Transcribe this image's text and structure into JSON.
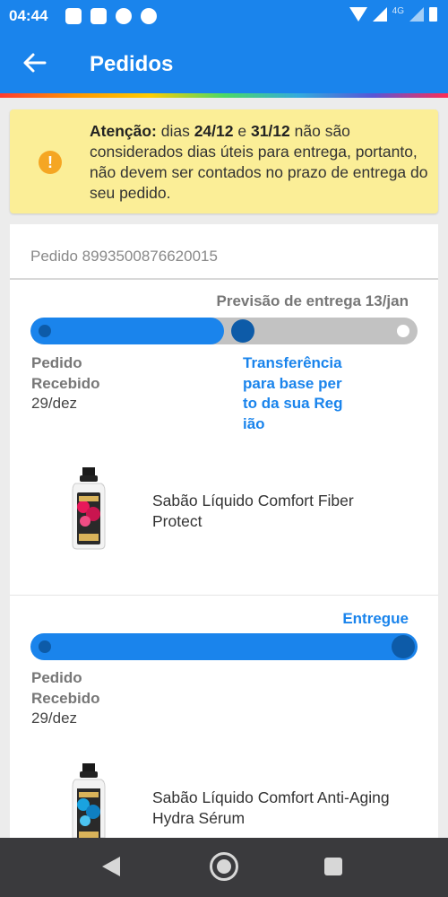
{
  "status_bar": {
    "time": "04:44",
    "network_label": "4G"
  },
  "appbar": {
    "title": "Pedidos"
  },
  "alert": {
    "prefix": "Atenção:",
    "t1": " dias ",
    "date1": "24/12",
    "t2": " e ",
    "date2": "31/12",
    "t3": " não são considerados dias úteis para entrega, portanto, não devem ser contados no prazo de entrega do seu pedido.",
    "icon_glyph": "!"
  },
  "order": {
    "id_label": "Pedido 8993500876620015",
    "items": [
      {
        "status_label": "Previsão de entrega 13/jan",
        "progress": 0.5,
        "step_left": "Pedido Recebido",
        "step_left_date": "29/dez",
        "step_current": "Transferência para base perto da sua Região",
        "product_name": "Sabão Líquido Comfort Fiber Protect"
      },
      {
        "status_label": "Entregue",
        "progress": 1.0,
        "step_left": "Pedido Recebido",
        "step_left_date": "29/dez",
        "product_name": "Sabão Líquido Comfort Anti-Aging Hydra Sérum"
      }
    ]
  },
  "colors": {
    "primary": "#1a84ec",
    "dark_dot": "#0d5ba8",
    "alert_bg": "#fbee97",
    "alert_icon": "#f5a623",
    "track_bg": "#c2c2c2"
  },
  "icons": {
    "back": "arrow-left-icon",
    "alert": "exclamation-circle-icon",
    "nav_back": "triangle-back-icon",
    "nav_home": "circle-home-icon",
    "nav_recent": "square-recents-icon"
  }
}
